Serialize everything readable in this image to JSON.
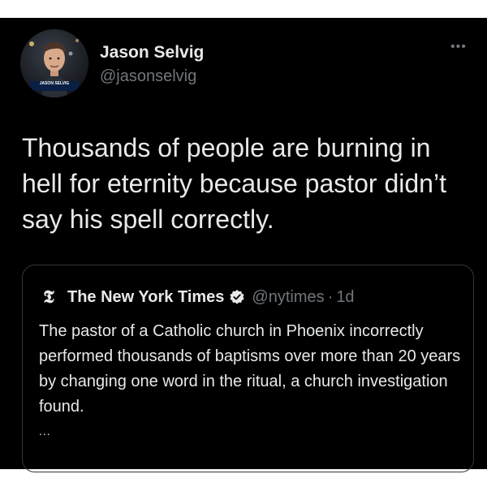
{
  "tweet": {
    "author": {
      "display_name": "Jason Selvig",
      "handle": "@jasonselvig",
      "avatar_caption": "JASON SELVIG"
    },
    "more_icon": "more-horizontal-icon",
    "more_glyph": "•••",
    "text": "Thousands of people are burning in hell for eternity because pastor didn’t say his spell correctly."
  },
  "quote": {
    "logo_glyph": "𝕿",
    "name": "The New York Times",
    "verified_icon": "verified-badge-icon",
    "handle": "@nytimes",
    "dot": "·",
    "time": "1d",
    "text": "The pastor of a Catholic church in Phoenix incorrectly performed thousands of baptisms over more than 20 years by changing one word in the ritual, a church investigation found.",
    "ellipsis": "..."
  },
  "colors": {
    "background": "#000000",
    "text_primary": "#e7e9ea",
    "text_secondary": "#71767b",
    "border": "#333639"
  }
}
